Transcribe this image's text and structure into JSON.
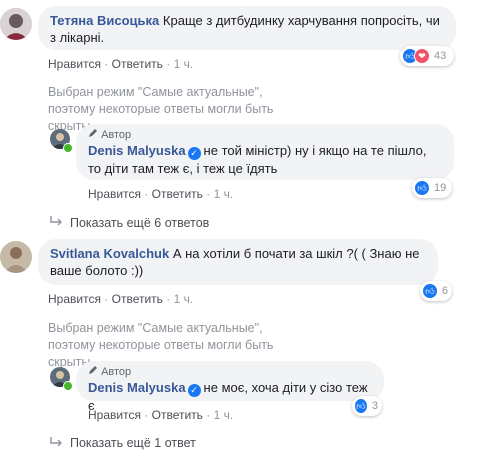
{
  "comments": [
    {
      "author": "Тетяна Висоцька",
      "text": "Краще з дитбудинку харчування попросіть, чи з лікарні.",
      "like": "Нравится",
      "reply": "Ответить",
      "time": "1 ч.",
      "reaction_count": "43",
      "reactions": [
        "like-icon",
        "love-icon"
      ],
      "notice": "Выбран режим \"Самые актуальные\", поэтому некоторые ответы могли быть скрыты.",
      "reply_item": {
        "tag": "Автор",
        "author": "Denis Malyuska",
        "text": "не той міністр) ну і якщо на те пішло, то діти там теж є, і теж це їдять",
        "like": "Нравится",
        "reply": "Ответить",
        "time": "1 ч.",
        "reaction_count": "19"
      },
      "more_replies": "Показать ещё 6 ответов"
    },
    {
      "author": "Svitlana Kovalchuk",
      "text": "А на хотіли б почати за шкіл ?( ( Знаю не ваше болото :))",
      "like": "Нравится",
      "reply": "Ответить",
      "time": "1 ч.",
      "reaction_count": "6",
      "notice": "Выбран режим \"Самые актуальные\", поэтому некоторые ответы могли быть скрыты.",
      "reply_item": {
        "tag": "Автор",
        "author": "Denis Malyuska",
        "text": "не моє, хоча діти у сізо теж є",
        "like": "Нравится",
        "reply": "Ответить",
        "time": "1 ч.",
        "reaction_count": "3"
      },
      "more_replies": "Показать ещё 1 ответ"
    }
  ],
  "colors": {
    "name": "#385898",
    "bubble": "#f2f3f5",
    "like": "#1877f2",
    "love": "#f25268",
    "muted": "#90949c"
  }
}
